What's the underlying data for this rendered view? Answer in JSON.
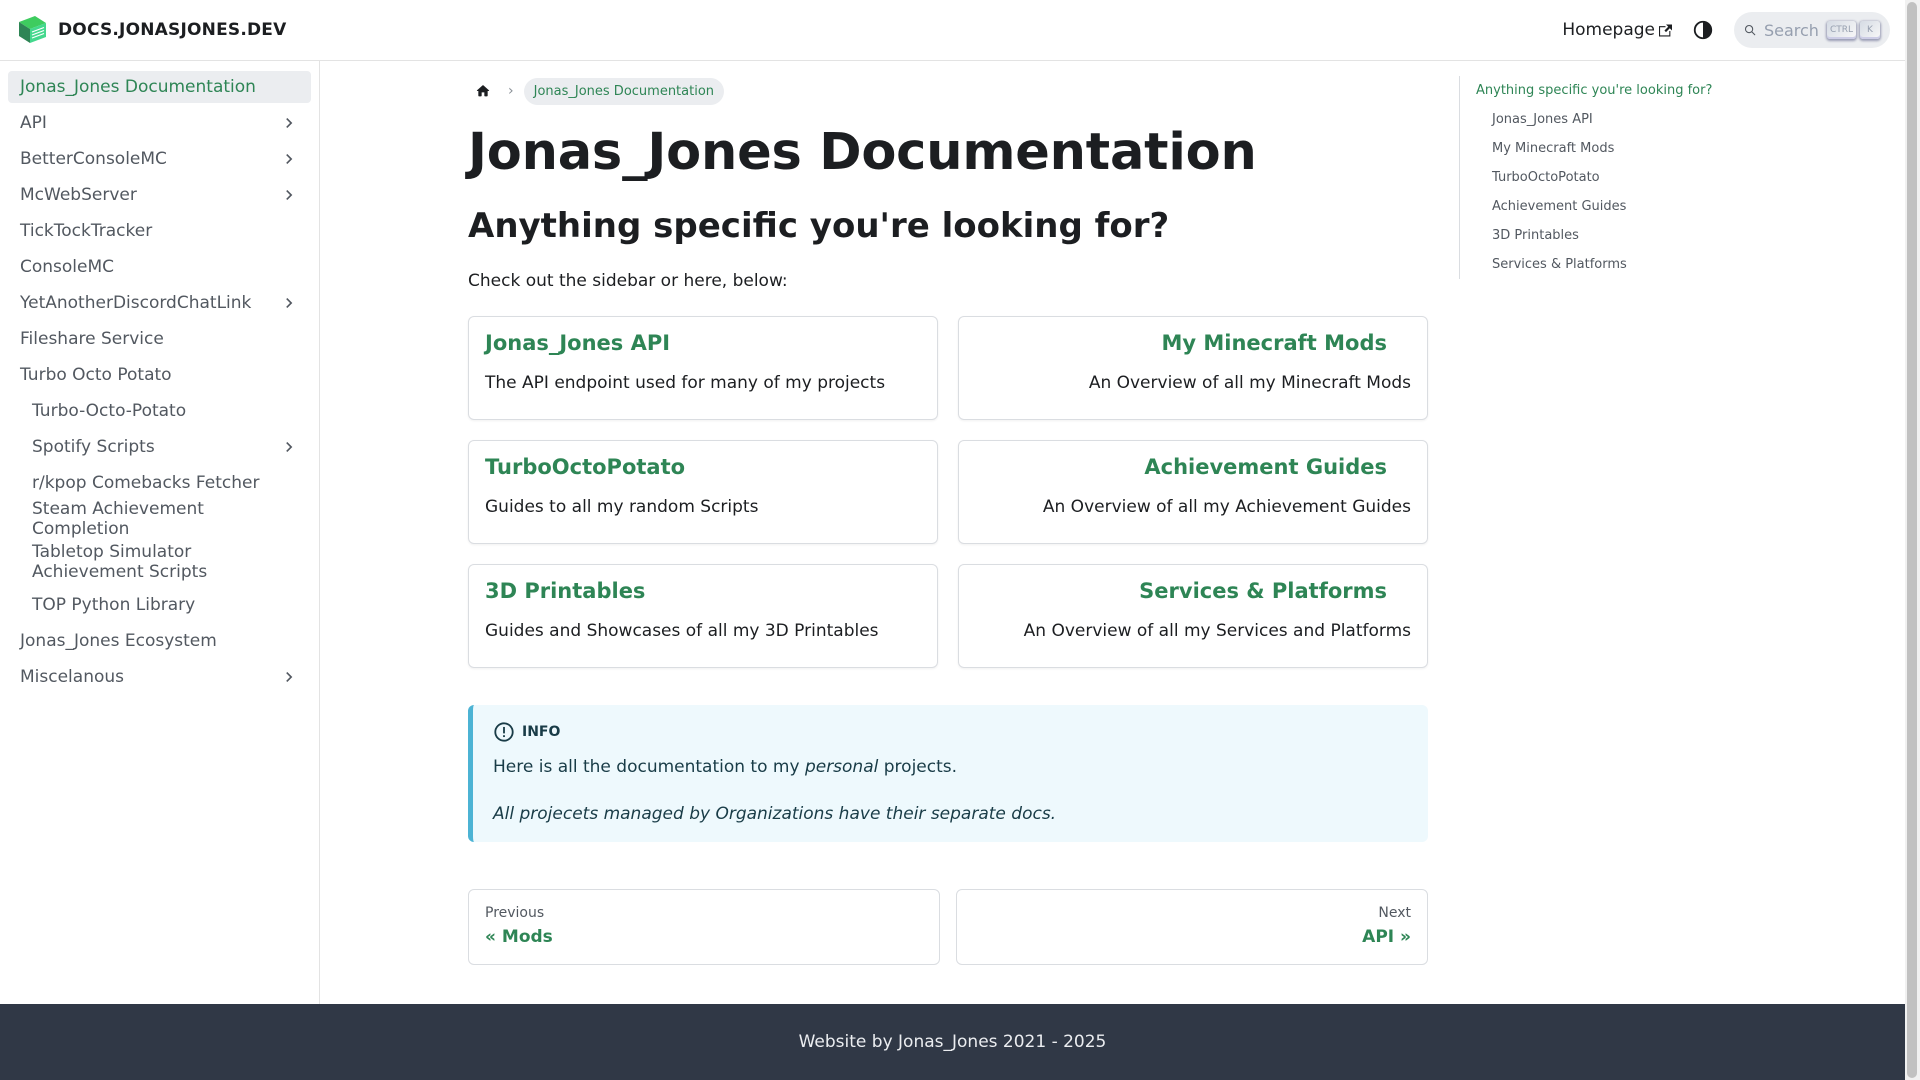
{
  "navbar": {
    "brand_title": "DOCS.JONASJONES.DEV",
    "homepage_label": "Homepage",
    "search_placeholder": "Search",
    "kbd_ctrl": "CTRL",
    "kbd_k": "K"
  },
  "sidebar": {
    "items": [
      {
        "label": "Jonas_Jones Documentation",
        "active": true,
        "expandable": false,
        "level": 0
      },
      {
        "label": "API",
        "expandable": true,
        "level": 0
      },
      {
        "label": "BetterConsoleMC",
        "expandable": true,
        "level": 0
      },
      {
        "label": "McWebServer",
        "expandable": true,
        "level": 0
      },
      {
        "label": "TickTockTracker",
        "expandable": false,
        "level": 0
      },
      {
        "label": "ConsoleMC",
        "expandable": false,
        "level": 0
      },
      {
        "label": "YetAnotherDiscordChatLink",
        "expandable": true,
        "level": 0
      },
      {
        "label": "Fileshare Service",
        "expandable": false,
        "level": 0
      },
      {
        "label": "Turbo Octo Potato",
        "expandable": false,
        "level": 0
      },
      {
        "label": "Turbo-Octo-Potato",
        "expandable": false,
        "level": 1
      },
      {
        "label": "Spotify Scripts",
        "expandable": true,
        "level": 1
      },
      {
        "label": "r/kpop Comebacks Fetcher",
        "expandable": false,
        "level": 1
      },
      {
        "label": "Steam Achievement Completion",
        "expandable": false,
        "level": 1
      },
      {
        "label": "Tabletop Simulator Achievement Scripts",
        "expandable": false,
        "level": 1
      },
      {
        "label": "TOP Python Library",
        "expandable": false,
        "level": 1
      },
      {
        "label": "Jonas_Jones Ecosystem",
        "expandable": false,
        "level": 0
      },
      {
        "label": "Miscelanous",
        "expandable": true,
        "level": 0
      }
    ]
  },
  "breadcrumb": {
    "current": "Jonas_Jones Documentation"
  },
  "main": {
    "title": "Jonas_Jones Documentation",
    "subtitle": "Anything specific you're looking for?",
    "intro": "Check out the sidebar or here, below:",
    "cards": [
      {
        "title": "Jonas_Jones API",
        "desc": "The API endpoint used for many of my projects"
      },
      {
        "title": "My Minecraft Mods",
        "desc": "An Overview of all my Minecraft Mods"
      },
      {
        "title": "TurboOctoPotato",
        "desc": "Guides to all my random Scripts"
      },
      {
        "title": "Achievement Guides",
        "desc": "An Overview of all my Achievement Guides"
      },
      {
        "title": "3D Printables",
        "desc": "Guides and Showcases of all my 3D Printables"
      },
      {
        "title": "Services & Platforms",
        "desc": "An Overview of all my Services and Platforms"
      }
    ],
    "info": {
      "heading": "INFO",
      "text_before": "Here is all the documentation to my ",
      "text_em": "personal",
      "text_after": " projects.",
      "note": "All projecets managed by Organizations have their separate docs."
    },
    "pager": {
      "prev_sub": "Previous",
      "prev_label": "« Mods",
      "next_sub": "Next",
      "next_label": "API »"
    }
  },
  "toc": {
    "items": [
      {
        "label": "Anything specific you're looking for?",
        "active": true,
        "level": 0
      },
      {
        "label": "Jonas_Jones API",
        "level": 1
      },
      {
        "label": "My Minecraft Mods",
        "level": 1
      },
      {
        "label": "TurboOctoPotato",
        "level": 1
      },
      {
        "label": "Achievement Guides",
        "level": 1
      },
      {
        "label": "3D Printables",
        "level": 1
      },
      {
        "label": "Services & Platforms",
        "level": 1
      }
    ]
  },
  "footer": {
    "text": "Website by Jonas_Jones 2021 - 2025"
  },
  "colors": {
    "accent": "#2e8555",
    "info_border": "#4cb3d4",
    "footer_bg": "#303846"
  }
}
